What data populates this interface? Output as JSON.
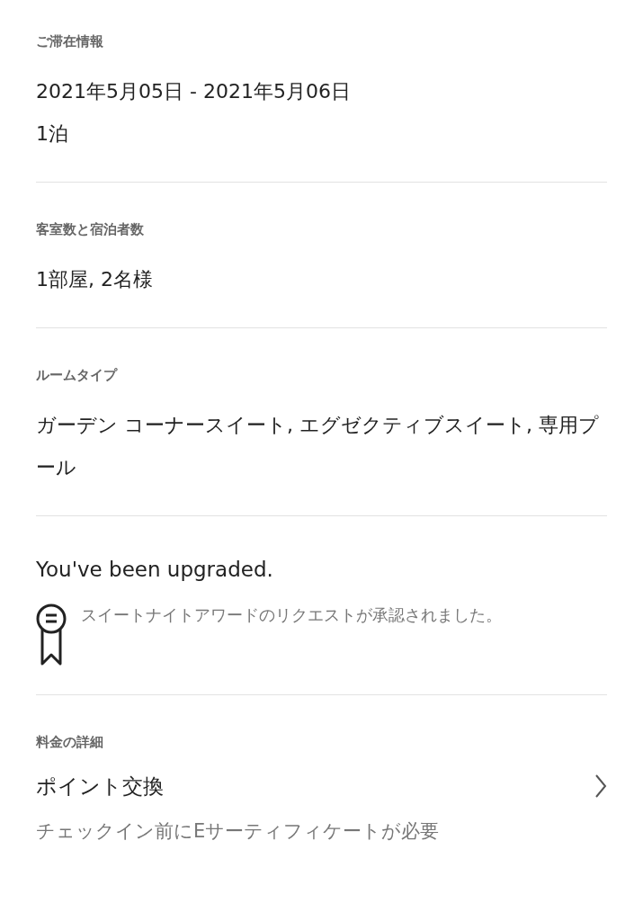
{
  "sections": [
    {
      "label": "ご滞在情報",
      "lines": [
        "2021年5月05日 - 2021年5月06日",
        "1泊"
      ]
    },
    {
      "label": "客室数と宿泊者数",
      "lines": [
        "1部屋, 2名様"
      ]
    },
    {
      "label": "ルームタイプ",
      "lines": [
        "ガーデン コーナースイート, エグゼクティブスイート, 専用プール"
      ]
    }
  ],
  "upgrade": {
    "title": "You've been upgraded.",
    "message": "スイートナイトアワードのリクエストが承認されました。"
  },
  "pricing": {
    "label": "料金の詳細",
    "title": "ポイント交換",
    "note": "チェックイン前にEサーティフィケートが必要"
  }
}
